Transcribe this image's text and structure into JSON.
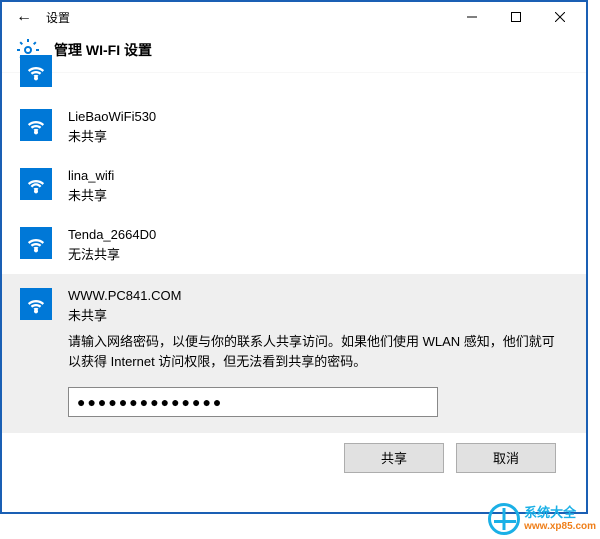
{
  "titlebar": {
    "title": "设置"
  },
  "header": {
    "title": "管理 WI-FI 设置"
  },
  "networks": [
    {
      "name": "LieBaoWiFi530",
      "status": "未共享"
    },
    {
      "name": "lina_wifi",
      "status": "未共享"
    },
    {
      "name": "Tenda_2664D0",
      "status": "无法共享"
    }
  ],
  "expanded": {
    "name": "WWW.PC841.COM",
    "status": "未共享",
    "help": "请输入网络密码，以便与你的联系人共享访问。如果他们使用 WLAN 感知，他们就可以获得 Internet 访问权限，但无法看到共享的密码。",
    "password_mask": "●●●●●●●●●●●●●●",
    "share_label": "共享",
    "cancel_label": "取消"
  },
  "watermark": {
    "brand": "系统大全",
    "url": "www.xp85.com"
  }
}
